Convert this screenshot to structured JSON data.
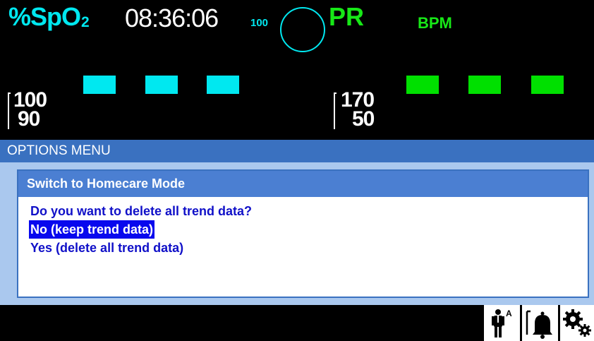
{
  "monitor": {
    "spo2_label": "%SpO",
    "spo2_subscript": "2",
    "clock": "08:36:06",
    "pleth_scale": "100",
    "pr_label": "PR",
    "bpm_label": "BPM",
    "spo2_limits": {
      "high": "100",
      "low": "90"
    },
    "pr_limits": {
      "high": "170",
      "low": "50"
    },
    "colors": {
      "spo2": "#00e8f0",
      "pr": "#17e817"
    }
  },
  "options_menu": {
    "title": "OPTIONS MENU",
    "dialog": {
      "title": "Switch to Homecare Mode",
      "question": "Do you want to delete all trend data?",
      "options": [
        {
          "label": "No (keep trend data)",
          "selected": true
        },
        {
          "label": "Yes (delete all trend data)",
          "selected": false
        }
      ]
    }
  },
  "status_bar": {
    "buttons": [
      {
        "icon": "patient-adult-icon",
        "badge": "A"
      },
      {
        "icon": "alarm-bell-icon"
      },
      {
        "icon": "settings-gears-icon"
      }
    ]
  }
}
